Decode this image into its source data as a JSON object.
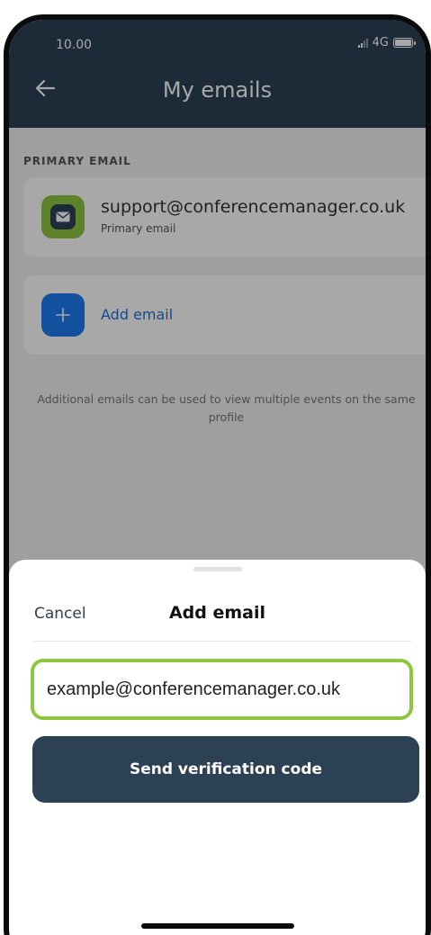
{
  "status_bar": {
    "time": "10.00",
    "network": "4G"
  },
  "header": {
    "title": "My emails"
  },
  "main": {
    "section_label": "PRIMARY EMAIL",
    "primary_email": {
      "address": "support@conferencemanager.co.uk",
      "subtitle": "Primary email"
    },
    "add_email_label": "Add email",
    "hint": "Additional emails can be used to view multiple events on the same profile"
  },
  "sheet": {
    "cancel_label": "Cancel",
    "title": "Add email",
    "email_value": "example@conferencemanager.co.uk",
    "send_label": "Send verification code"
  },
  "colors": {
    "header": "#2d4155",
    "accent_green": "#8dc63f",
    "accent_blue": "#1e7bf0"
  },
  "icons": {
    "back": "arrow-left-icon",
    "mail": "envelope-icon",
    "add": "plus-icon",
    "signal": "signal-icon",
    "battery": "battery-icon"
  }
}
